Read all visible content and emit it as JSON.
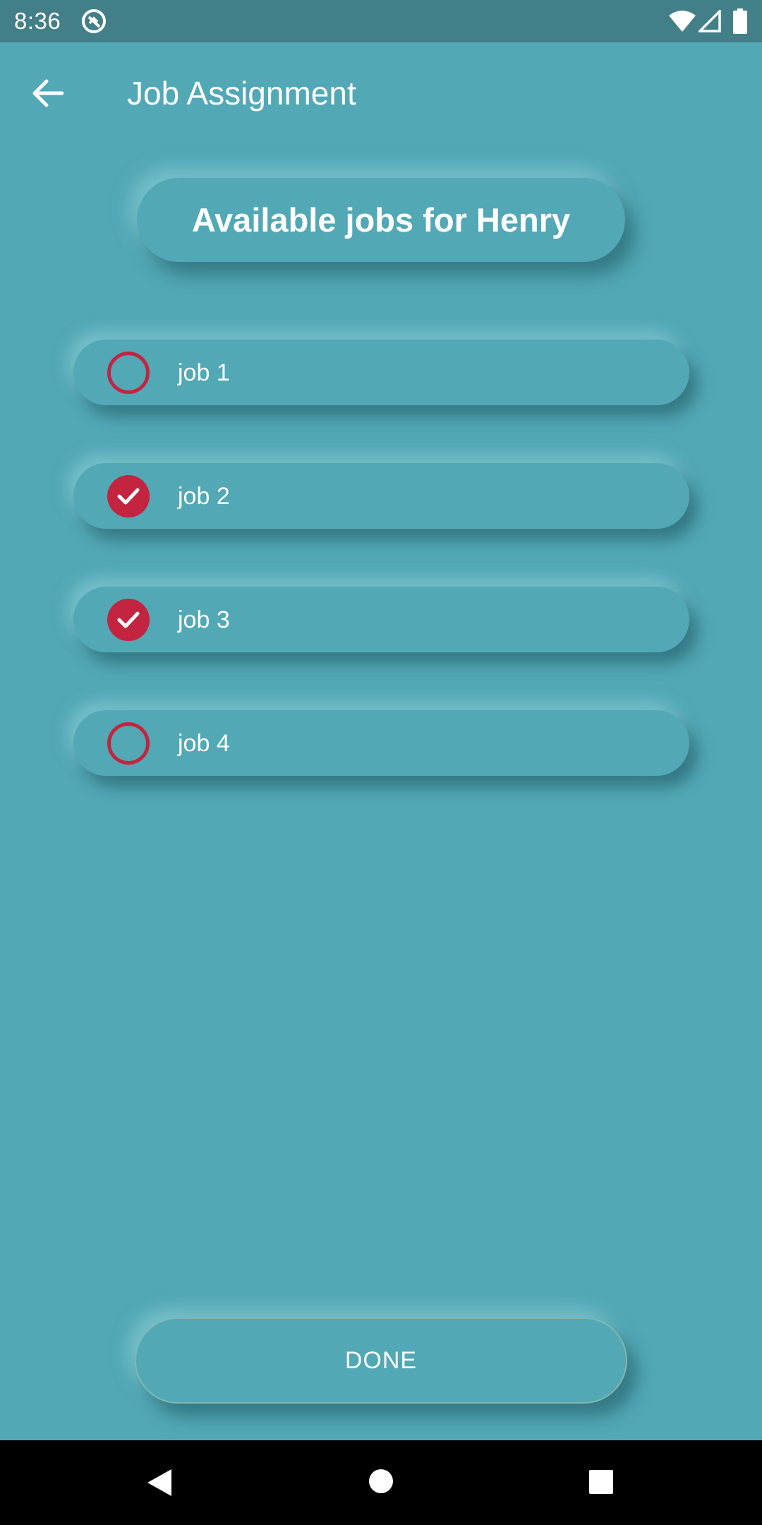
{
  "status_bar": {
    "time": "8:36",
    "icons": [
      "app-notification-icon",
      "wifi-icon",
      "cell-signal-icon",
      "battery-icon"
    ]
  },
  "app_bar": {
    "back_icon": "arrow-left-icon",
    "title": "Job Assignment"
  },
  "heading": "Available jobs for Henry",
  "jobs": [
    {
      "label": "job 1",
      "checked": false
    },
    {
      "label": "job 2",
      "checked": true
    },
    {
      "label": "job 3",
      "checked": true
    },
    {
      "label": "job 4",
      "checked": false
    }
  ],
  "done_button": {
    "label": "DONE"
  },
  "nav_bar": {
    "icons": [
      "nav-back-triangle-icon",
      "nav-home-circle-icon",
      "nav-recents-square-icon"
    ]
  },
  "colors": {
    "background": "#52a8b5",
    "status_bar": "#437f88",
    "accent": "#c3243f",
    "text": "#ffffff"
  }
}
